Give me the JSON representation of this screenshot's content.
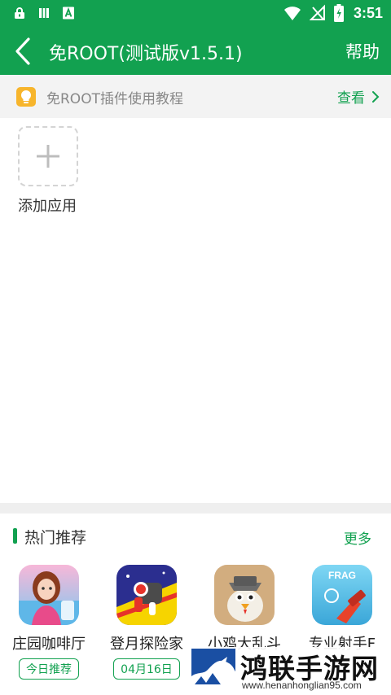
{
  "status_bar": {
    "time": "3:51",
    "left_icons": [
      "lock-icon",
      "sim-card-icon",
      "text-a-icon"
    ],
    "right_icons": [
      "wifi-icon",
      "no-signal-icon",
      "battery-charging-icon"
    ]
  },
  "app_bar": {
    "back_icon": "chevron-left-icon",
    "title": "免ROOT(测试版v1.5.1)",
    "help_label": "帮助",
    "color": "#12a150"
  },
  "tutorial": {
    "icon": "lightbulb-icon",
    "text": "免ROOT插件使用教程",
    "link_label": "查看",
    "link_icon": "chevron-right-icon"
  },
  "add_app": {
    "icon": "plus-icon",
    "label": "添加应用"
  },
  "hot": {
    "title": "热门推荐",
    "more_label": "更多",
    "apps": [
      {
        "name": "庄园咖啡厅",
        "tag": "今日推荐"
      },
      {
        "name": "登月探险家",
        "tag": "04月16日"
      },
      {
        "name": "小鸡大乱斗",
        "tag": ""
      },
      {
        "name": "专业射手F",
        "tag": ""
      }
    ]
  },
  "watermark": {
    "title": "鸿联手游网",
    "url": "www.henanhonglian95.com"
  }
}
